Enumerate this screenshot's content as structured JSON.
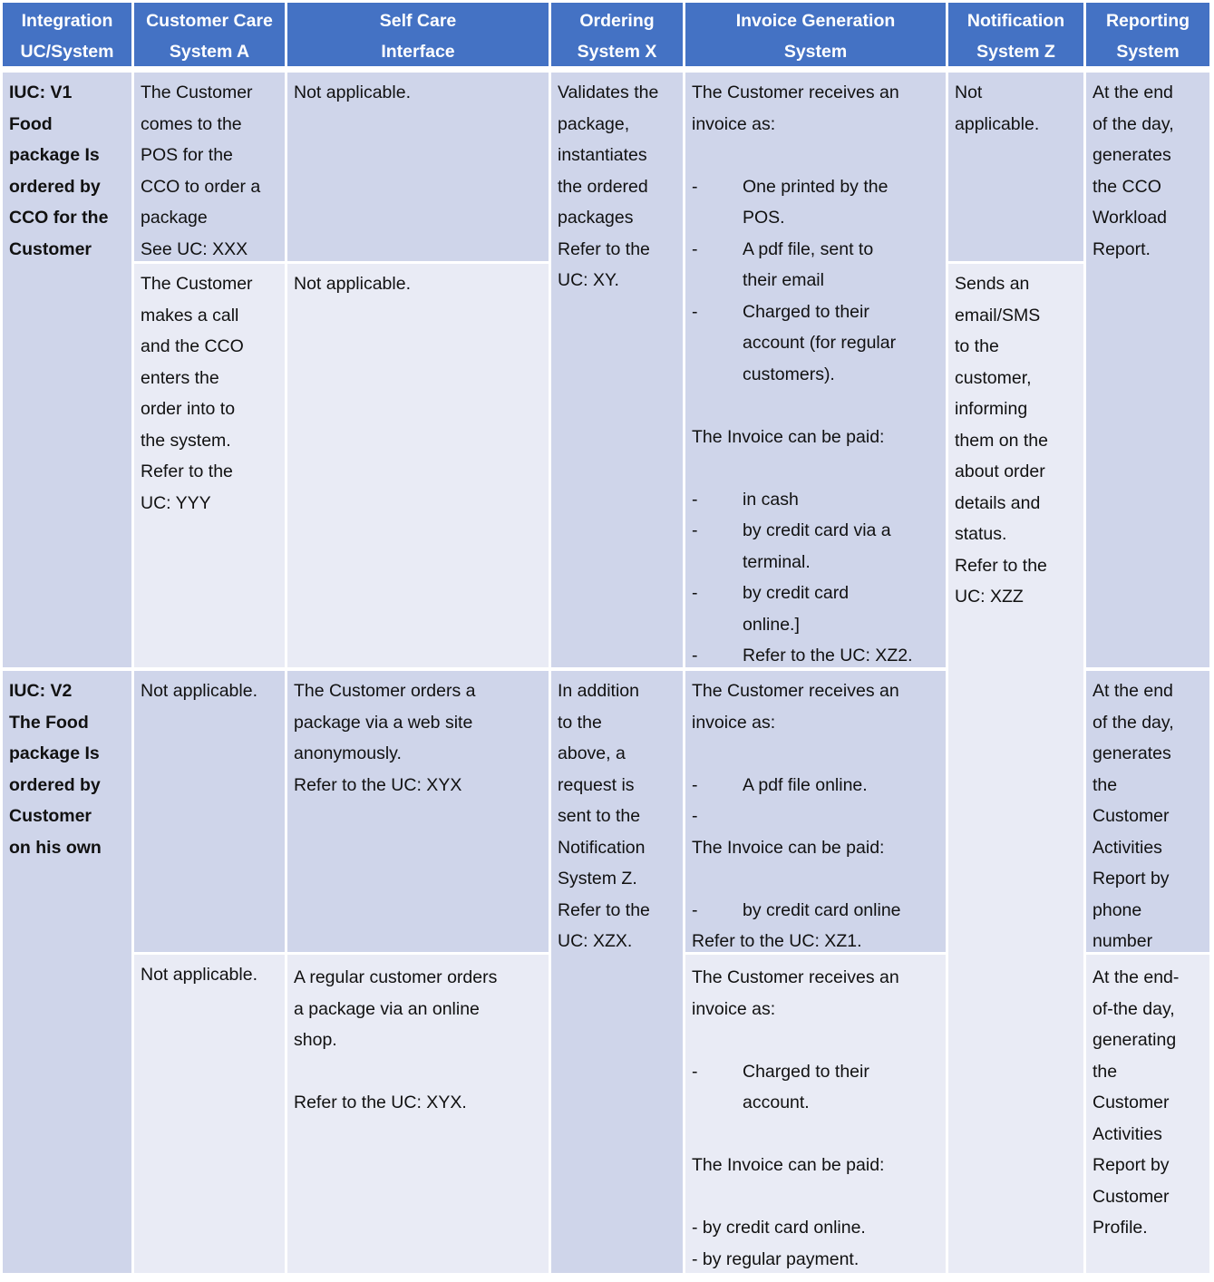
{
  "colors": {
    "header": "#4472C4",
    "cell_dark": "#CFD5EA",
    "cell_light": "#E9EBF5"
  },
  "headers": [
    [
      "Integration",
      "UC/System"
    ],
    [
      "Customer Care",
      "System A"
    ],
    [
      "Self Care",
      "Interface"
    ],
    [
      "Ordering",
      "System X"
    ],
    [
      "Invoice Generation",
      "System"
    ],
    [
      "Notification",
      "System Z"
    ],
    [
      "Reporting",
      "System"
    ]
  ],
  "cells": [
    {
      "id": "v1-integration",
      "bold": true,
      "lines": [
        {
          "text": "IUC: V1"
        },
        {
          "text": "Food"
        },
        {
          "text": "package Is"
        },
        {
          "text": "ordered by"
        },
        {
          "text": "CCO for the"
        },
        {
          "text": "Customer"
        }
      ]
    },
    {
      "id": "v1a-customer-care",
      "lines": [
        {
          "text": "The Customer"
        },
        {
          "text": "comes to the"
        },
        {
          "text": "POS for the"
        },
        {
          "text": "CCO to order a"
        },
        {
          "text": "package"
        },
        {
          "text": "See UC: XXX"
        }
      ]
    },
    {
      "id": "v1b-customer-care",
      "lines": [
        {
          "text": "The Customer"
        },
        {
          "text": "makes a call"
        },
        {
          "text": "and the CCO"
        },
        {
          "text": "enters the"
        },
        {
          "text": "order into to"
        },
        {
          "text": "the system."
        },
        {
          "text": "Refer to the"
        },
        {
          "text": "UC: YYY"
        }
      ]
    },
    {
      "id": "v1a-self-care",
      "lines": [
        {
          "text": "Not applicable."
        }
      ]
    },
    {
      "id": "v1b-self-care",
      "lines": [
        {
          "text": "Not applicable."
        }
      ]
    },
    {
      "id": "v1-ordering",
      "lines": [
        {
          "text": "Validates the"
        },
        {
          "text": "package,"
        },
        {
          "text": "instantiates"
        },
        {
          "text": "the ordered"
        },
        {
          "text": "packages"
        },
        {
          "text": "Refer to the"
        },
        {
          "text": "UC: XY."
        }
      ]
    },
    {
      "id": "v1-invoice",
      "lines": [
        {
          "text": "The Customer receives an"
        },
        {
          "text": "invoice as:"
        },
        {
          "text": ""
        },
        {
          "marker": "-",
          "text": "One printed by the"
        },
        {
          "indent": true,
          "text": "POS."
        },
        {
          "marker": "-",
          "text": "A pdf file, sent  to"
        },
        {
          "indent": true,
          "text": "their email"
        },
        {
          "marker": "-",
          "text": "Charged to their"
        },
        {
          "indent": true,
          "text": "account (for regular"
        },
        {
          "indent": true,
          "text": "customers)."
        },
        {
          "text": ""
        },
        {
          "text": "The Invoice can be paid:"
        },
        {
          "text": ""
        },
        {
          "marker": "-",
          "text": "in cash"
        },
        {
          "marker": "-",
          "text": "by credit card via a"
        },
        {
          "indent": true,
          "text": "terminal."
        },
        {
          "marker": "-",
          "text": "by credit card"
        },
        {
          "indent": true,
          "text": "online.]"
        },
        {
          "marker": "-",
          "text": "Refer to the UC: XZ2."
        }
      ]
    },
    {
      "id": "v1a-notification",
      "lines": [
        {
          "text": "Not"
        },
        {
          "text": "applicable."
        }
      ]
    },
    {
      "id": "v1b-notification",
      "lines": [
        {
          "text": "Sends an"
        },
        {
          "text": "email/SMS"
        },
        {
          "text": "to the"
        },
        {
          "text": "customer,"
        },
        {
          "text": "informing"
        },
        {
          "text": "them on the"
        },
        {
          "text": "about  order"
        },
        {
          "text": "details and"
        },
        {
          "text": "status."
        },
        {
          "text": "Refer to the"
        },
        {
          "text": "UC: XZZ"
        }
      ]
    },
    {
      "id": "v1-reporting",
      "lines": [
        {
          "text": "At the end"
        },
        {
          "text": "of the day,"
        },
        {
          "text": "generates"
        },
        {
          "text": "the CCO"
        },
        {
          "text": "Workload"
        },
        {
          "text": "Report."
        }
      ]
    },
    {
      "id": "v2-integration",
      "bold": true,
      "lines": [
        {
          "text": "IUC: V2"
        },
        {
          "text": "The Food"
        },
        {
          "text": "package Is"
        },
        {
          "text": "ordered by"
        },
        {
          "text": "Customer"
        },
        {
          "text": "on his own"
        }
      ]
    },
    {
      "id": "v2a-customer-care",
      "lines": [
        {
          "text": "Not applicable."
        }
      ]
    },
    {
      "id": "v2b-customer-care",
      "lines": [
        {
          "text": "Not applicable."
        }
      ]
    },
    {
      "id": "v2a-self-care",
      "lines": [
        {
          "text": "The Customer orders a"
        },
        {
          "text": "package via a web site"
        },
        {
          "text": "anonymously."
        },
        {
          "text": "Refer to the UC: XYX"
        }
      ]
    },
    {
      "id": "v2b-self-care",
      "lines": [
        {
          "text": "A regular customer orders"
        },
        {
          "text": "a package via an online"
        },
        {
          "text": "shop."
        },
        {
          "text": ""
        },
        {
          "text": "Refer to the UC: XYX."
        }
      ]
    },
    {
      "id": "v2-ordering",
      "lines": [
        {
          "text": "In addition"
        },
        {
          "text": "to the"
        },
        {
          "text": "above, a"
        },
        {
          "text": "request is"
        },
        {
          "text": "sent to the"
        },
        {
          "text": "Notification"
        },
        {
          "text": "System Z."
        },
        {
          "text": "Refer to the"
        },
        {
          "text": "UC: XZX."
        }
      ]
    },
    {
      "id": "v2a-invoice",
      "lines": [
        {
          "text": "The Customer receives an"
        },
        {
          "text": "invoice as:"
        },
        {
          "text": ""
        },
        {
          "marker": "-",
          "text": "A pdf file online."
        },
        {
          "marker": "-",
          "text": ""
        },
        {
          "text": "The Invoice can be paid:"
        },
        {
          "text": ""
        },
        {
          "marker": "-",
          "text": "by credit card online"
        },
        {
          "text": "Refer to the UC: XZ1."
        }
      ]
    },
    {
      "id": "v2b-invoice",
      "lines": [
        {
          "text": "The Customer receives an"
        },
        {
          "text": "invoice as:"
        },
        {
          "text": ""
        },
        {
          "marker": "-",
          "text": "Charged to their"
        },
        {
          "indent": true,
          "text": "account."
        },
        {
          "text": ""
        },
        {
          "text": "The Invoice can be paid:"
        },
        {
          "text": ""
        },
        {
          "text": "- by credit card online."
        },
        {
          "text": "- by regular payment."
        }
      ]
    },
    {
      "id": "v2a-reporting",
      "lines": [
        {
          "text": "At the end"
        },
        {
          "text": "of the day,"
        },
        {
          "text": "generates"
        },
        {
          "text": "the"
        },
        {
          "text": "Customer"
        },
        {
          "text": "Activities"
        },
        {
          "text": "Report by"
        },
        {
          "text": "phone"
        },
        {
          "text": "number"
        }
      ]
    },
    {
      "id": "v2b-reporting",
      "lines": [
        {
          "text": "At the end-"
        },
        {
          "text": "of-the day,"
        },
        {
          "text": "generating"
        },
        {
          "text": "the"
        },
        {
          "text": "Customer"
        },
        {
          "text": "Activities"
        },
        {
          "text": "Report by"
        },
        {
          "text": "Customer"
        },
        {
          "text": "Profile."
        }
      ]
    }
  ]
}
